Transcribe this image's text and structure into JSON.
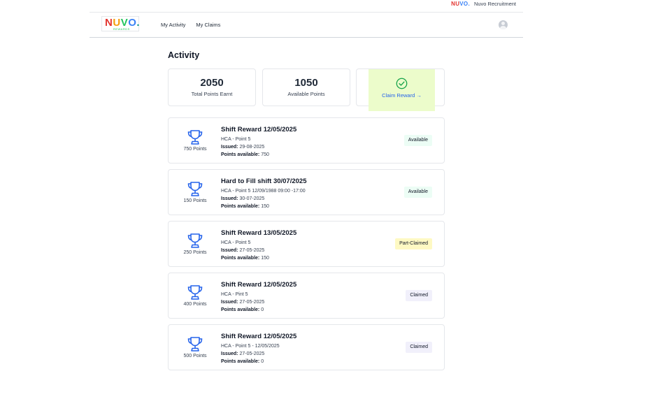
{
  "topbar": {
    "logo_text": "NUVO.",
    "company": "Nuvo Recruitment"
  },
  "header": {
    "logo_text": "NUVO.",
    "logo_sub": "REWARDS",
    "nav": [
      "My Activity",
      "My Claims"
    ]
  },
  "page": {
    "title": "Activity"
  },
  "stats": {
    "total_points": "2050",
    "total_label": "Total Points Earnt",
    "available_points": "1050",
    "available_label": "Available Points",
    "claim_label": "Claim Reward →"
  },
  "rewards": [
    {
      "points": "750 Points",
      "title": "Shift Reward 12/05/2025",
      "detail": "HCA - Point 5",
      "issued_label": "Issued:",
      "issued": "29-08-2025",
      "avail_label": "Points available:",
      "avail": "750",
      "status": "Available"
    },
    {
      "points": "150 Points",
      "title": "Hard to Fill shift 30/07/2025",
      "detail": "HCA - Point 5 12/09/1988 09:00 -17:00",
      "issued_label": "Issued:",
      "issued": "30-07-2025",
      "avail_label": "Points available:",
      "avail": "150",
      "status": "Available"
    },
    {
      "points": "250 Points",
      "title": "Shift Reward 13/05/2025",
      "detail": "HCA - Point 5",
      "issued_label": "Issued:",
      "issued": "27-05-2025",
      "avail_label": "Points available:",
      "avail": "150",
      "status": "Part-Claimed"
    },
    {
      "points": "400 Points",
      "title": "Shift Reward 12/05/2025",
      "detail": "HCA - Pint 5",
      "issued_label": "Issued:",
      "issued": "27-05-2025",
      "avail_label": "Points available:",
      "avail": "0",
      "status": "Claimed"
    },
    {
      "points": "500 Points",
      "title": "Shift Reward 12/05/2025",
      "detail": "HCA - Point 5 - 12/05/2025",
      "issued_label": "Issued:",
      "issued": "27-05-2025",
      "avail_label": "Points available:",
      "avail": "0",
      "status": "Claimed"
    }
  ],
  "colors": {
    "accent": "#2563eb",
    "trophy": "#2563eb",
    "check": "#16a34a",
    "claim_bg": "#ecfccb"
  }
}
